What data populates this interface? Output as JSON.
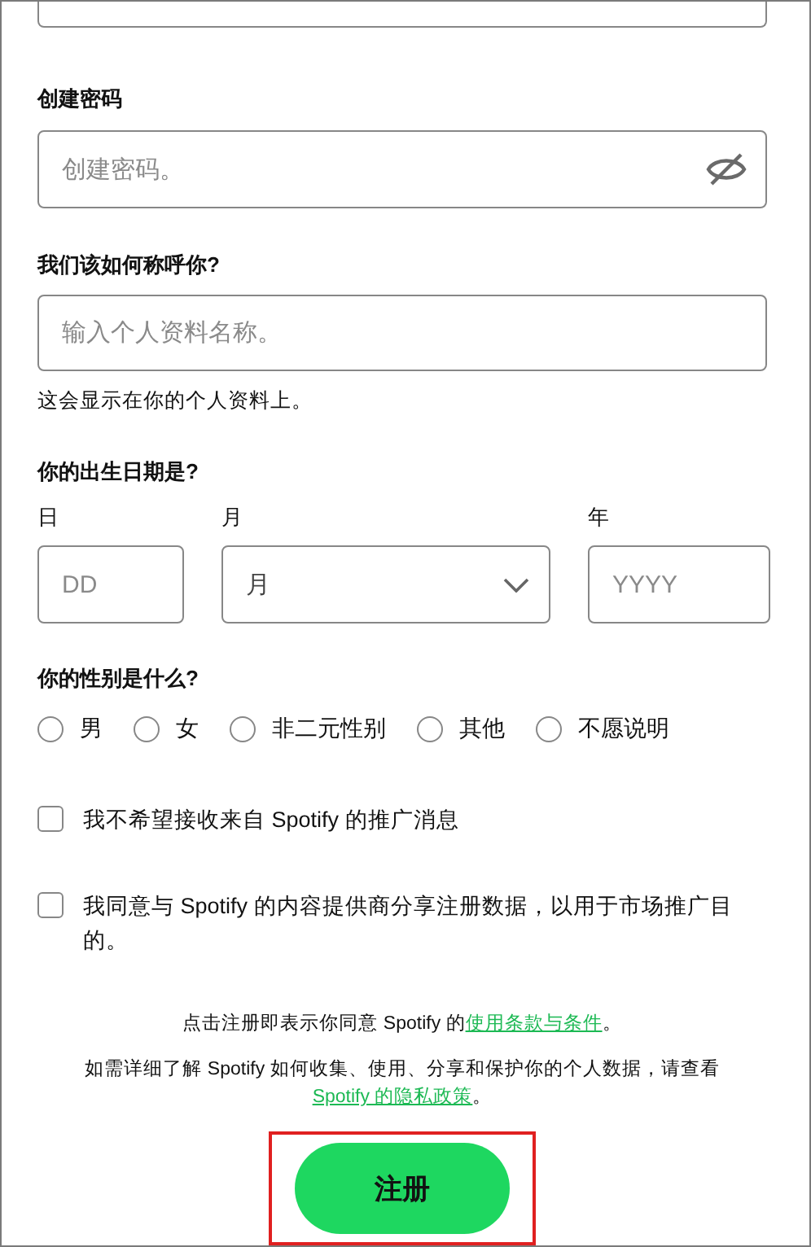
{
  "password": {
    "label": "创建密码",
    "placeholder": "创建密码。",
    "hidden": true
  },
  "profile_name": {
    "label": "我们该如何称呼你?",
    "placeholder": "输入个人资料名称。",
    "hint": "这会显示在你的个人资料上。"
  },
  "birth_date": {
    "label": "你的出生日期是?",
    "day": {
      "label": "日",
      "placeholder": "DD"
    },
    "month": {
      "label": "月",
      "value": "月"
    },
    "year": {
      "label": "年",
      "placeholder": "YYYY"
    }
  },
  "gender": {
    "label": "你的性别是什么?",
    "options": [
      {
        "label": "男",
        "selected": false
      },
      {
        "label": "女",
        "selected": false
      },
      {
        "label": "非二元性别",
        "selected": false
      },
      {
        "label": "其他",
        "selected": false
      },
      {
        "label": "不愿说明",
        "selected": false
      }
    ]
  },
  "consents": [
    {
      "label": "我不希望接收来自 Spotify 的推广消息",
      "checked": false
    },
    {
      "label": "我同意与 Spotify 的内容提供商分享注册数据，以用于市场推广目的。",
      "checked": false
    }
  ],
  "terms": {
    "text": "点击注册即表示你同意 Spotify 的",
    "link": "使用条款与条件",
    "end": "。"
  },
  "privacy": {
    "text": "如需详细了解 Spotify 如何收集、使用、分享和保护你的个人数据，请查看 ",
    "link": "Spotify 的隐私政策",
    "end": "。"
  },
  "signup_button": {
    "label": "注册",
    "highlighted": true
  }
}
